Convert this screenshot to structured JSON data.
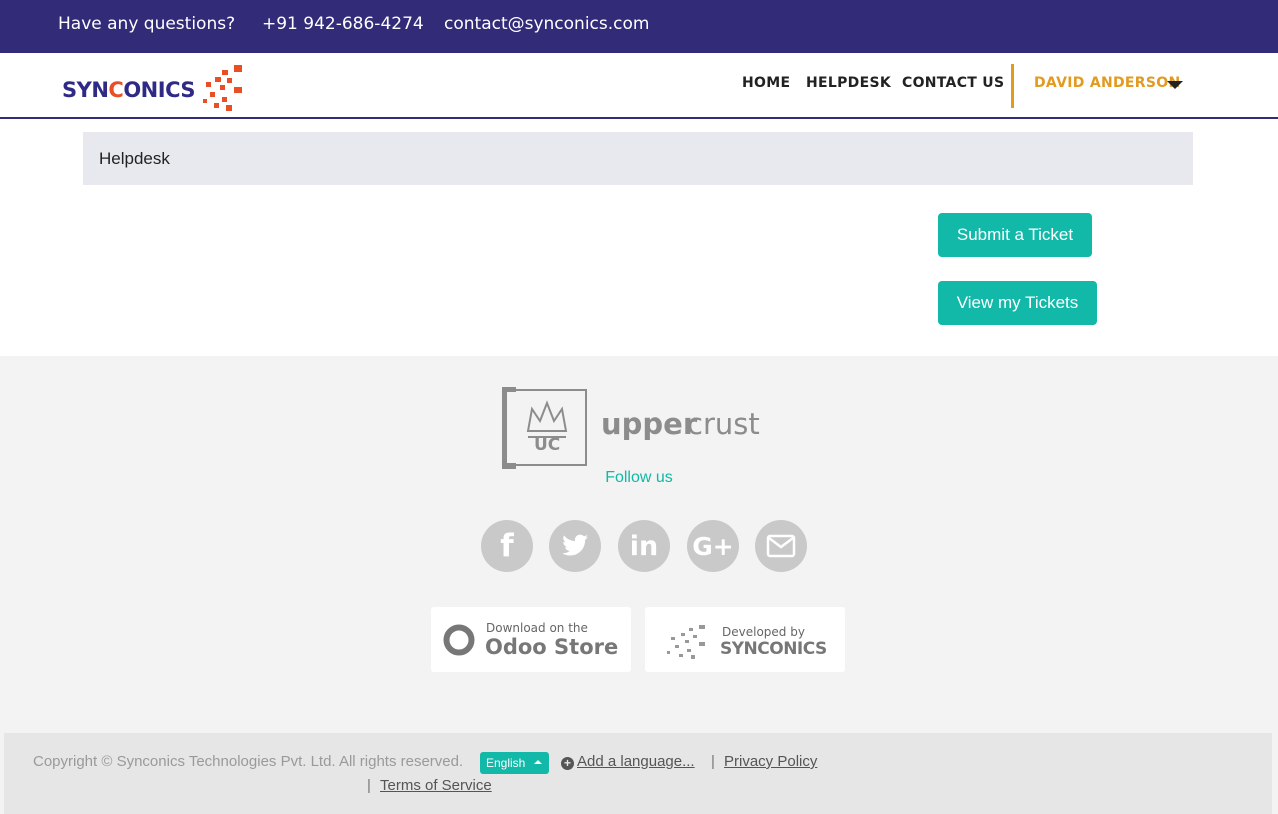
{
  "topbar": {
    "question": "Have any questions?",
    "phone": "+91 942-686-4274",
    "email": "contact@synconics.com"
  },
  "header": {
    "logo": {
      "part1": "SYN",
      "part2": "C",
      "part3": "ONICS"
    },
    "nav": {
      "home": "HOME",
      "helpdesk": "HELPDESK",
      "contact": "CONTACT US",
      "user": "DAVID ANDERSON"
    }
  },
  "breadcrumb": {
    "label": "Helpdesk"
  },
  "actions": {
    "submit_label": "Submit a Ticket",
    "view_label": "View my Tickets"
  },
  "footer": {
    "brand_logo": {
      "mark": "UC",
      "word_bold": "upper",
      "word_light": "crust"
    },
    "follow_label": "Follow us",
    "social": [
      "facebook-icon",
      "twitter-icon",
      "linkedin-icon",
      "google-plus-icon",
      "envelope-icon"
    ],
    "badges": {
      "odoo_line1": "Download on the",
      "odoo_line2": "Odoo Store",
      "dev_line1": "Developed by",
      "dev_line2": "SYNCONICS"
    }
  },
  "copyright": {
    "text": "Copyright © Synconics Technologies Pvt. Ltd. All rights reserved.",
    "language": "English",
    "add_language": "Add a language...",
    "privacy": "Privacy Policy",
    "terms": "Terms of Service"
  },
  "colors": {
    "brand_navy": "#312b78",
    "accent_teal": "#12b8a8",
    "user_orange": "#e29a1f",
    "logo_red": "#e94e24"
  }
}
